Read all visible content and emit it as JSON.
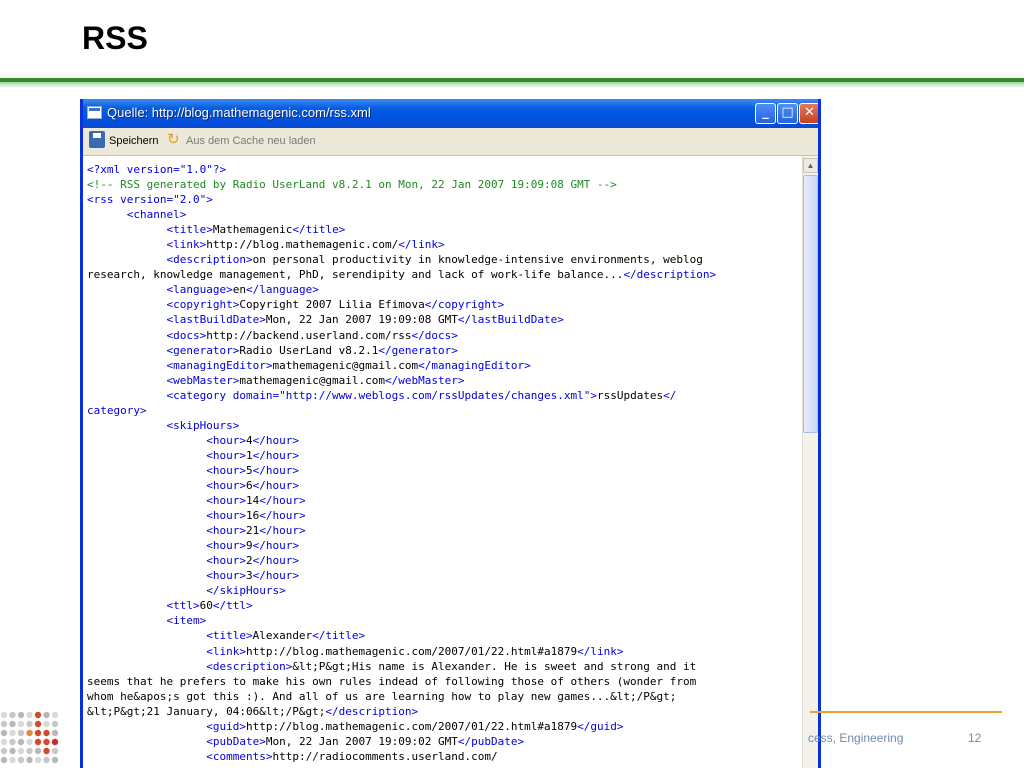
{
  "slide": {
    "title": "RSS",
    "footer_text": "cess, Engineering",
    "page_number": "12"
  },
  "window": {
    "title": "Quelle: http://blog.mathemagenic.com/rss.xml",
    "buttons": {
      "minimize": "_",
      "maximize": "□",
      "close": "✕"
    }
  },
  "toolbar": {
    "save_label": "Speichern",
    "reload_label": "Aus dem Cache neu laden"
  },
  "source_lines": [
    [
      [
        "pi",
        "<?xml version=\"1.0\"?>"
      ]
    ],
    [
      [
        "cm",
        "<!-- RSS generated by Radio UserLand v8.2.1 on Mon, 22 Jan 2007 19:09:08 GMT -->"
      ]
    ],
    [
      [
        "tag",
        "<rss version=\"2.0\">"
      ]
    ],
    [
      [
        "txt",
        "      "
      ],
      [
        "tag",
        "<channel>"
      ]
    ],
    [
      [
        "txt",
        "            "
      ],
      [
        "tag",
        "<title>"
      ],
      [
        "txt",
        "Mathemagenic"
      ],
      [
        "tag",
        "</title>"
      ]
    ],
    [
      [
        "txt",
        "            "
      ],
      [
        "tag",
        "<link>"
      ],
      [
        "txt",
        "http://blog.mathemagenic.com/"
      ],
      [
        "tag",
        "</link>"
      ]
    ],
    [
      [
        "txt",
        "            "
      ],
      [
        "tag",
        "<description>"
      ],
      [
        "txt",
        "on personal productivity in knowledge-intensive environments, weblog"
      ]
    ],
    [
      [
        "txt",
        "research, knowledge management, PhD, serendipity and lack of work-life balance..."
      ],
      [
        "tag",
        "</description>"
      ]
    ],
    [
      [
        "txt",
        "            "
      ],
      [
        "tag",
        "<language>"
      ],
      [
        "txt",
        "en"
      ],
      [
        "tag",
        "</language>"
      ]
    ],
    [
      [
        "txt",
        "            "
      ],
      [
        "tag",
        "<copyright>"
      ],
      [
        "txt",
        "Copyright 2007 Lilia Efimova"
      ],
      [
        "tag",
        "</copyright>"
      ]
    ],
    [
      [
        "txt",
        "            "
      ],
      [
        "tag",
        "<lastBuildDate>"
      ],
      [
        "txt",
        "Mon, 22 Jan 2007 19:09:08 GMT"
      ],
      [
        "tag",
        "</lastBuildDate>"
      ]
    ],
    [
      [
        "txt",
        "            "
      ],
      [
        "tag",
        "<docs>"
      ],
      [
        "txt",
        "http://backend.userland.com/rss"
      ],
      [
        "tag",
        "</docs>"
      ]
    ],
    [
      [
        "txt",
        "            "
      ],
      [
        "tag",
        "<generator>"
      ],
      [
        "txt",
        "Radio UserLand v8.2.1"
      ],
      [
        "tag",
        "</generator>"
      ]
    ],
    [
      [
        "txt",
        "            "
      ],
      [
        "tag",
        "<managingEditor>"
      ],
      [
        "txt",
        "mathemagenic@gmail.com"
      ],
      [
        "tag",
        "</managingEditor>"
      ]
    ],
    [
      [
        "txt",
        "            "
      ],
      [
        "tag",
        "<webMaster>"
      ],
      [
        "txt",
        "mathemagenic@gmail.com"
      ],
      [
        "tag",
        "</webMaster>"
      ]
    ],
    [
      [
        "txt",
        "            "
      ],
      [
        "tag",
        "<category domain=\"http://www.weblogs.com/rssUpdates/changes.xml\">"
      ],
      [
        "txt",
        "rssUpdates"
      ],
      [
        "tag",
        "</"
      ]
    ],
    [
      [
        "tag",
        "category>"
      ]
    ],
    [
      [
        "txt",
        "            "
      ],
      [
        "tag",
        "<skipHours>"
      ]
    ],
    [
      [
        "txt",
        "                  "
      ],
      [
        "tag",
        "<hour>"
      ],
      [
        "txt",
        "4"
      ],
      [
        "tag",
        "</hour>"
      ]
    ],
    [
      [
        "txt",
        "                  "
      ],
      [
        "tag",
        "<hour>"
      ],
      [
        "txt",
        "1"
      ],
      [
        "tag",
        "</hour>"
      ]
    ],
    [
      [
        "txt",
        "                  "
      ],
      [
        "tag",
        "<hour>"
      ],
      [
        "txt",
        "5"
      ],
      [
        "tag",
        "</hour>"
      ]
    ],
    [
      [
        "txt",
        "                  "
      ],
      [
        "tag",
        "<hour>"
      ],
      [
        "txt",
        "6"
      ],
      [
        "tag",
        "</hour>"
      ]
    ],
    [
      [
        "txt",
        "                  "
      ],
      [
        "tag",
        "<hour>"
      ],
      [
        "txt",
        "14"
      ],
      [
        "tag",
        "</hour>"
      ]
    ],
    [
      [
        "txt",
        "                  "
      ],
      [
        "tag",
        "<hour>"
      ],
      [
        "txt",
        "16"
      ],
      [
        "tag",
        "</hour>"
      ]
    ],
    [
      [
        "txt",
        "                  "
      ],
      [
        "tag",
        "<hour>"
      ],
      [
        "txt",
        "21"
      ],
      [
        "tag",
        "</hour>"
      ]
    ],
    [
      [
        "txt",
        "                  "
      ],
      [
        "tag",
        "<hour>"
      ],
      [
        "txt",
        "9"
      ],
      [
        "tag",
        "</hour>"
      ]
    ],
    [
      [
        "txt",
        "                  "
      ],
      [
        "tag",
        "<hour>"
      ],
      [
        "txt",
        "2"
      ],
      [
        "tag",
        "</hour>"
      ]
    ],
    [
      [
        "txt",
        "                  "
      ],
      [
        "tag",
        "<hour>"
      ],
      [
        "txt",
        "3"
      ],
      [
        "tag",
        "</hour>"
      ]
    ],
    [
      [
        "txt",
        "                  "
      ],
      [
        "tag",
        "</skipHours>"
      ]
    ],
    [
      [
        "txt",
        "            "
      ],
      [
        "tag",
        "<ttl>"
      ],
      [
        "txt",
        "60"
      ],
      [
        "tag",
        "</ttl>"
      ]
    ],
    [
      [
        "txt",
        "            "
      ],
      [
        "tag",
        "<item>"
      ]
    ],
    [
      [
        "txt",
        "                  "
      ],
      [
        "tag",
        "<title>"
      ],
      [
        "txt",
        "Alexander"
      ],
      [
        "tag",
        "</title>"
      ]
    ],
    [
      [
        "txt",
        "                  "
      ],
      [
        "tag",
        "<link>"
      ],
      [
        "txt",
        "http://blog.mathemagenic.com/2007/01/22.html#a1879"
      ],
      [
        "tag",
        "</link>"
      ]
    ],
    [
      [
        "txt",
        "                  "
      ],
      [
        "tag",
        "<description>"
      ],
      [
        "txt",
        "&lt;P&gt;His name is Alexander. He is sweet and strong and it"
      ]
    ],
    [
      [
        "txt",
        "seems that he prefers to make his own rules indead of following those of others (wonder from"
      ]
    ],
    [
      [
        "txt",
        "whom he&apos;s got this :). And all of us are learning how to play new games...&lt;/P&gt;"
      ]
    ],
    [
      [
        "txt",
        "&lt;P&gt;21 January, 04:06&lt;/P&gt;"
      ],
      [
        "tag",
        "</description>"
      ]
    ],
    [
      [
        "txt",
        "                  "
      ],
      [
        "tag",
        "<guid>"
      ],
      [
        "txt",
        "http://blog.mathemagenic.com/2007/01/22.html#a1879"
      ],
      [
        "tag",
        "</guid>"
      ]
    ],
    [
      [
        "txt",
        "                  "
      ],
      [
        "tag",
        "<pubDate>"
      ],
      [
        "txt",
        "Mon, 22 Jan 2007 19:09:02 GMT"
      ],
      [
        "tag",
        "</pubDate>"
      ]
    ],
    [
      [
        "txt",
        "                  "
      ],
      [
        "tag",
        "<comments>"
      ],
      [
        "txt",
        "http://radiocomments.userland.com/"
      ]
    ]
  ]
}
